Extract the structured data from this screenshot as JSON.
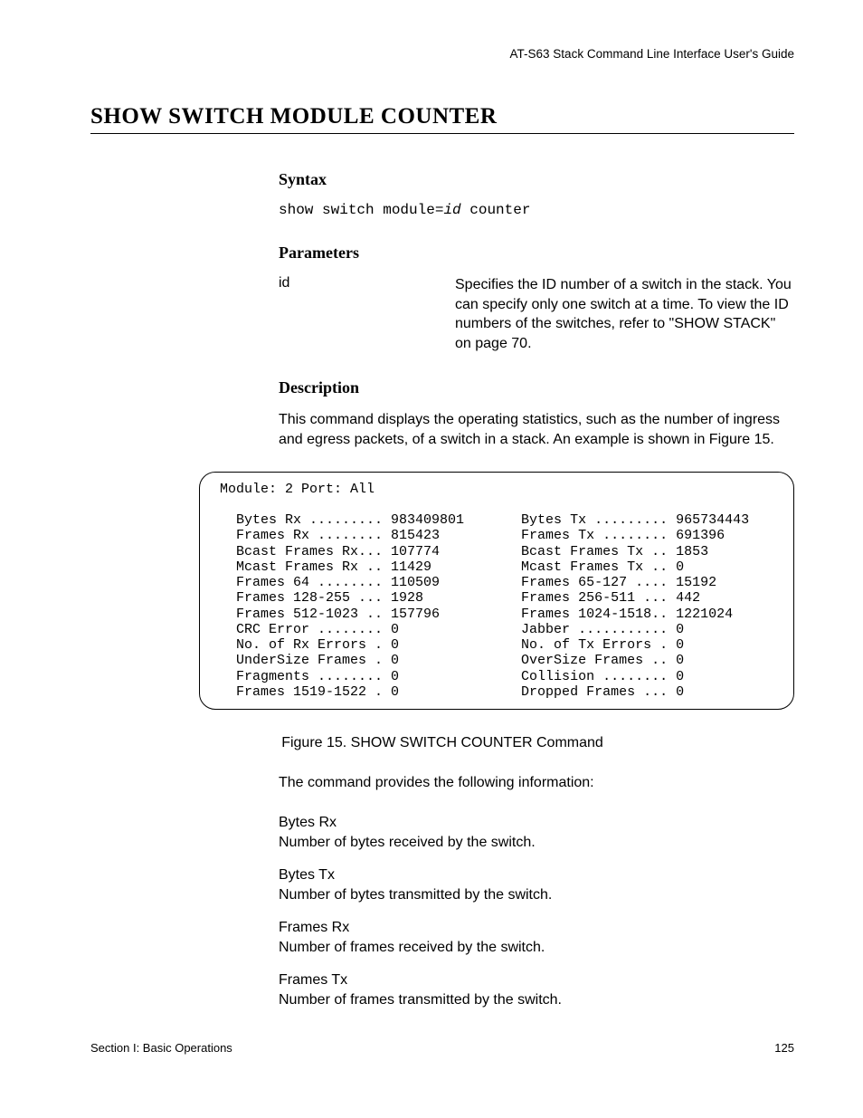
{
  "header": {
    "right": "AT-S63 Stack Command Line Interface User's Guide"
  },
  "title": "SHOW SWITCH MODULE COUNTER",
  "syntax": {
    "heading": "Syntax",
    "pre": "show switch module=",
    "italic": "id",
    "post": " counter"
  },
  "parameters": {
    "heading": "Parameters",
    "term": "id",
    "desc": "Specifies the ID number of a switch in the stack. You can specify only one switch at a time. To view the ID numbers of the switches, refer to \"SHOW STACK\" on page 70."
  },
  "description": {
    "heading": "Description",
    "paragraph": "This command displays the operating statistics, such as the number of ingress and egress packets, of a switch in a stack. An example is shown in Figure 15."
  },
  "figure": {
    "headerLine": "Module: 2 Port: All",
    "rows": [
      {
        "l": "Bytes Rx ......... 983409801",
        "r": "Bytes Tx ......... 965734443"
      },
      {
        "l": "Frames Rx ........ 815423",
        "r": "Frames Tx ........ 691396"
      },
      {
        "l": "Bcast Frames Rx... 107774",
        "r": "Bcast Frames Tx .. 1853"
      },
      {
        "l": "Mcast Frames Rx .. 11429",
        "r": "Mcast Frames Tx .. 0"
      },
      {
        "l": "Frames 64 ........ 110509",
        "r": "Frames 65-127 .... 15192"
      },
      {
        "l": "Frames 128-255 ... 1928",
        "r": "Frames 256-511 ... 442"
      },
      {
        "l": "Frames 512-1023 .. 157796",
        "r": "Frames 1024-1518.. 1221024"
      },
      {
        "l": "CRC Error ........ 0",
        "r": "Jabber ........... 0"
      },
      {
        "l": "No. of Rx Errors . 0",
        "r": "No. of Tx Errors . 0"
      },
      {
        "l": "UnderSize Frames . 0",
        "r": "OverSize Frames .. 0"
      },
      {
        "l": "Fragments ........ 0",
        "r": "Collision ........ 0"
      },
      {
        "l": "Frames 1519-1522 . 0",
        "r": "Dropped Frames ... 0"
      }
    ],
    "caption": "Figure 15. SHOW SWITCH COUNTER Command"
  },
  "afterFigure": {
    "lead": "The command provides the following information:",
    "items": [
      {
        "term": "Bytes Rx",
        "desc": "Number of bytes received by the switch."
      },
      {
        "term": "Bytes Tx",
        "desc": "Number of bytes transmitted by the switch."
      },
      {
        "term": "Frames Rx",
        "desc": "Number of frames received by the switch."
      },
      {
        "term": "Frames Tx",
        "desc": "Number of frames transmitted by the switch."
      }
    ]
  },
  "footer": {
    "left": "Section I: Basic Operations",
    "right": "125"
  }
}
